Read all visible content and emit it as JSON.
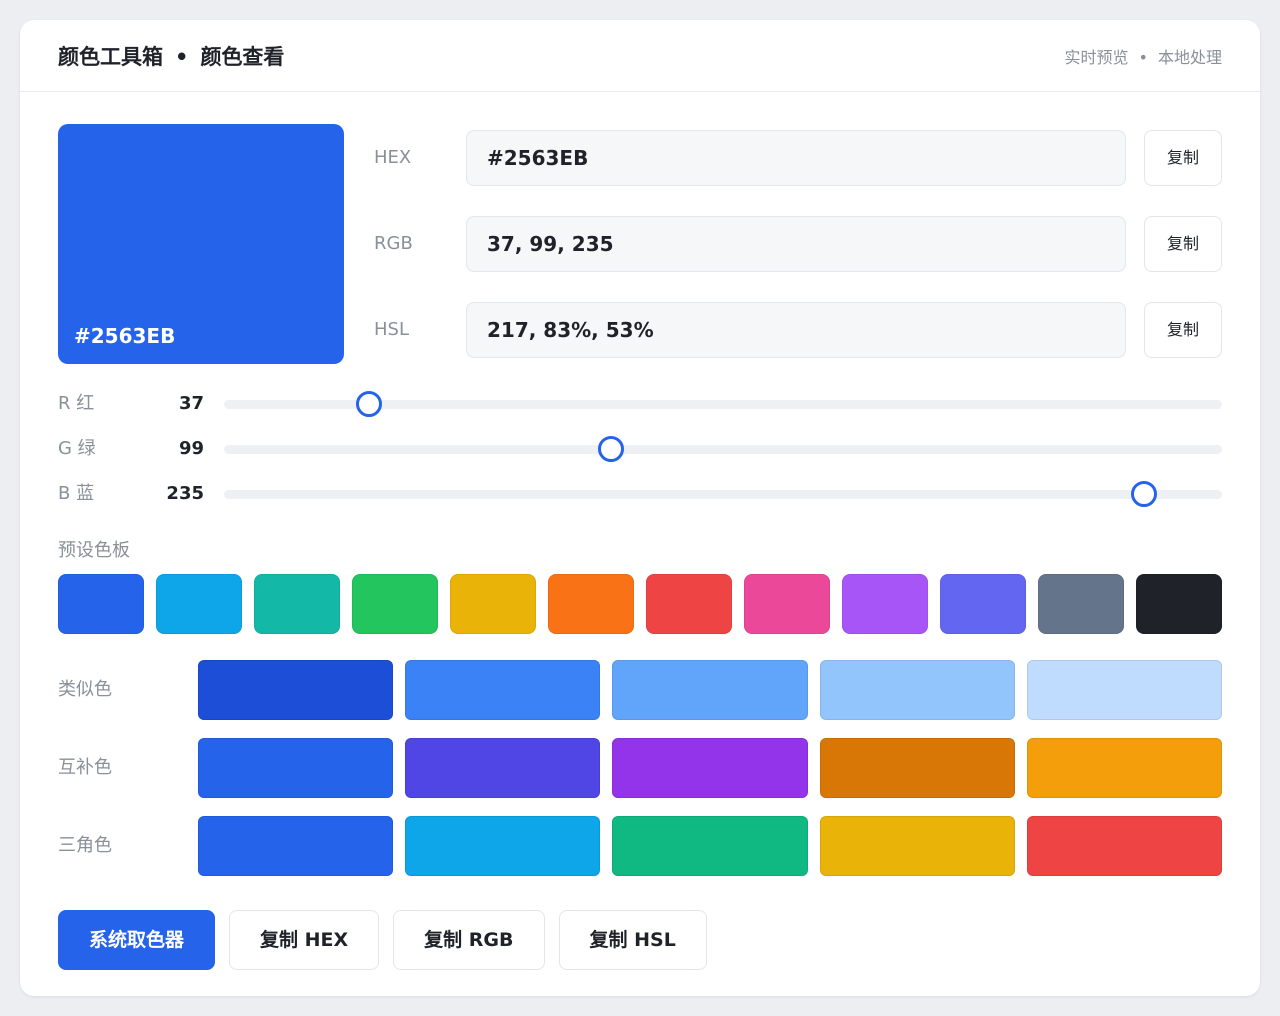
{
  "header": {
    "title_left": "颜色工具箱",
    "title_sep": "•",
    "title_right": "颜色查看",
    "meta_left": "实时预览",
    "meta_sep": "•",
    "meta_right": "本地处理"
  },
  "preview": {
    "color": "#2563EB",
    "label": "#2563EB"
  },
  "fields": [
    {
      "label": "HEX",
      "value": "#2563EB",
      "copy": "复制"
    },
    {
      "label": "RGB",
      "value": "37, 99, 235",
      "copy": "复制"
    },
    {
      "label": "HSL",
      "value": "217, 83%, 53%",
      "copy": "复制"
    }
  ],
  "sliders": [
    {
      "label": "R 红",
      "value": "37",
      "level": 37,
      "max": 255
    },
    {
      "label": "G 绿",
      "value": "99",
      "level": 99,
      "max": 255
    },
    {
      "label": "B 蓝",
      "value": "235",
      "level": 235,
      "max": 255
    }
  ],
  "palette": {
    "label": "预设色板",
    "colors": [
      "#2563EB",
      "#0EA5E9",
      "#14B8A6",
      "#22C55E",
      "#EAB308",
      "#F97316",
      "#EF4444",
      "#EC4899",
      "#A855F7",
      "#6366F1",
      "#64748B",
      "#1F2329"
    ]
  },
  "schemes": [
    {
      "label": "类似色",
      "colors": [
        "#1D4ED8",
        "#3B82F6",
        "#60A5FA",
        "#93C5FD",
        "#BFDBFE"
      ]
    },
    {
      "label": "互补色",
      "colors": [
        "#2563EB",
        "#4F46E5",
        "#9333EA",
        "#D97706",
        "#F59E0B"
      ]
    },
    {
      "label": "三角色",
      "colors": [
        "#2563EB",
        "#0EA5E9",
        "#10B981",
        "#EAB308",
        "#EF4444"
      ]
    }
  ],
  "actions": {
    "picker": "系统取色器",
    "copy_hex": "复制 HEX",
    "copy_rgb": "复制 RGB",
    "copy_hsl": "复制 HSL"
  }
}
